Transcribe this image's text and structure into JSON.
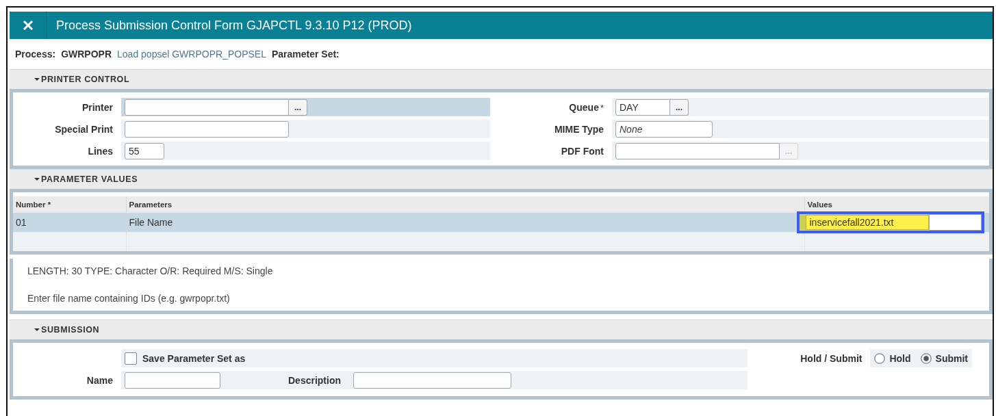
{
  "window": {
    "title": "Process Submission Control Form GJAPCTL 9.3.10 P12 (PROD)"
  },
  "process": {
    "label": "Process:",
    "code": "GWRPOPR",
    "description": "Load popsel GWRPOPR_POPSEL",
    "parameter_set_label": "Parameter Set:"
  },
  "printer_control": {
    "heading": "PRINTER CONTROL",
    "expanded": true,
    "left_fields": [
      {
        "label": "Printer",
        "kind": "long",
        "lookup_label": "...",
        "lookup_disabled": false,
        "focused": true
      },
      {
        "label": "Special Print",
        "kind": "long",
        "focused": false
      },
      {
        "label": "Lines",
        "kind": "short",
        "value": "55",
        "focused": false
      }
    ],
    "right_fields": [
      {
        "label": "Queue",
        "required_mark": "*",
        "kind": "short",
        "value": "DAY",
        "lookup_label": "...",
        "lookup_disabled": false,
        "focused": false
      },
      {
        "label": "MIME Type",
        "kind": "medium",
        "placeholder": "None",
        "focused": false
      },
      {
        "label": "PDF Font",
        "kind": "long",
        "lookup_label": "...",
        "lookup_disabled": true,
        "focused": false
      }
    ]
  },
  "parameter_values": {
    "heading": "PARAMETER VALUES",
    "expanded": true,
    "columns": [
      "Number *",
      "Parameters",
      "Values"
    ],
    "rows": [
      {
        "number": "01",
        "parameter": "File Name",
        "value": "inservicefall2021.txt",
        "selected": true,
        "focused": true
      }
    ],
    "info": [
      "LENGTH: 30 TYPE: Character O/R: Required M/S: Single",
      "Enter file name containing IDs (e.g. gwrpopr.txt)"
    ]
  },
  "submission": {
    "heading": "SUBMISSION",
    "expanded": true,
    "save_checkbox": {
      "label": "Save Parameter Set as",
      "checked": false
    },
    "name_field": {
      "label": "Name"
    },
    "description_field": {
      "label": "Description"
    },
    "hold_submit": {
      "label": "Hold / Submit",
      "options": [
        {
          "label": "Hold",
          "selected": false
        },
        {
          "label": "Submit",
          "selected": true
        }
      ]
    }
  }
}
